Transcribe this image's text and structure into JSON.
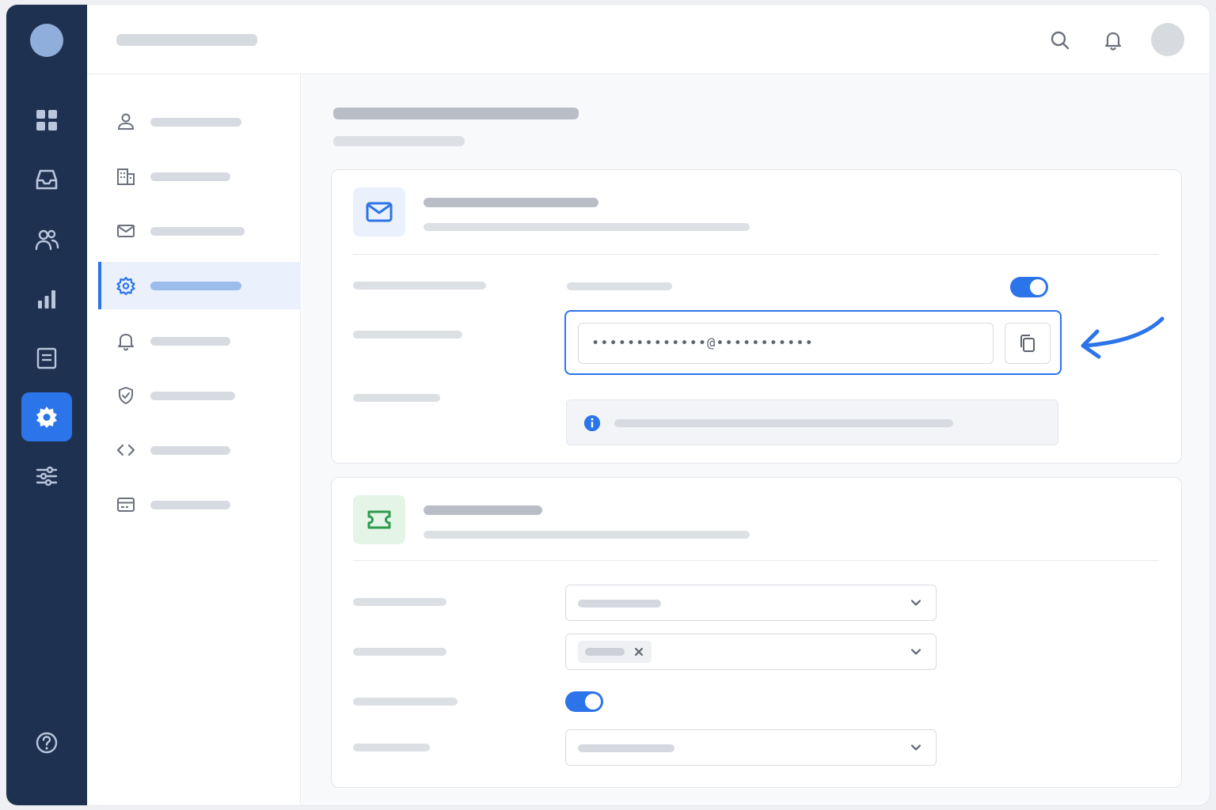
{
  "email": {
    "masked_address": "•••••••••••••@•••••••••••"
  },
  "colors": {
    "rail_background": "#1f3150",
    "accent": "#2c74ea",
    "email_icon_bg": "#eaf1fd",
    "ticket_icon_bg": "#e4f5e8",
    "ticket_icon": "#2e9b4c"
  },
  "rail": {
    "items": [
      "grid-icon",
      "inbox-icon",
      "users-icon",
      "bar-chart-icon",
      "document-icon",
      "gear-icon",
      "sliders-icon"
    ],
    "active_item": "gear-icon",
    "footer_item": "help-icon"
  },
  "topbar": {
    "icons": [
      "search-icon",
      "bell-icon"
    ]
  },
  "subnav": {
    "items": [
      "user-icon",
      "building-icon",
      "mail-icon",
      "gear-icon",
      "bell-icon",
      "shield-check-icon",
      "code-icon",
      "credit-card-icon"
    ],
    "active_item": "gear-icon"
  },
  "email_card": {
    "icon": "mail-icon",
    "forwarding_enabled": true,
    "info_icon": "info-icon",
    "copy_icon": "copy-icon"
  },
  "ticket_card": {
    "icon": "ticket-icon",
    "toggle_enabled": true,
    "chip_remove_icon": "close-icon",
    "dropdown_icon": "chevron-down-icon"
  },
  "annotation": {
    "arrow_icon": "arrow-pointer-icon"
  }
}
